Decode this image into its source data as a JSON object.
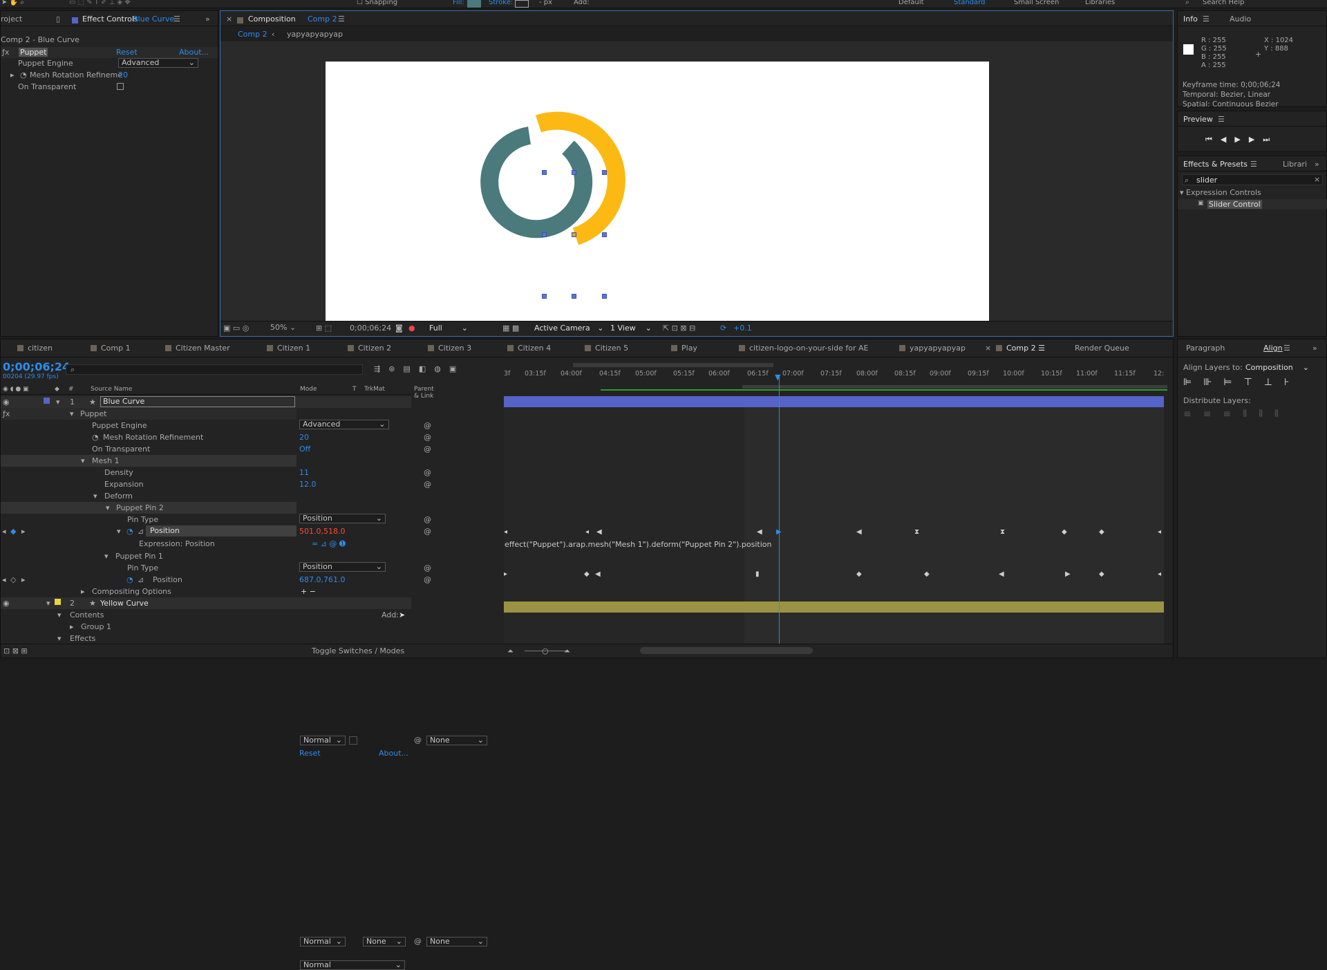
{
  "toolbar": {
    "snapping": "Snapping",
    "fill": "Fill:",
    "stroke": "Stroke:",
    "px": "- px",
    "add": "Add:",
    "workspaces": [
      "Default",
      "Standard",
      "Small Screen",
      "Libraries"
    ],
    "search_placeholder": "Search Help"
  },
  "effect_controls": {
    "project_tab": "roject",
    "tab_label": "Effect Controls",
    "tab_layer": "Blue Curve",
    "breadcrumb": "Comp 2 - Blue Curve",
    "effect_name": "Puppet",
    "reset": "Reset",
    "about": "About...",
    "rows": [
      {
        "label": "Puppet Engine",
        "value": "Advanced"
      },
      {
        "label": "Mesh Rotation Refineme",
        "value": "20"
      },
      {
        "label": "On Transparent",
        "value": ""
      }
    ]
  },
  "composition": {
    "tab_prefix": "Composition",
    "tab_name": "Comp 2",
    "sub_tabs": [
      "Comp 2",
      "yapyapyapyap"
    ],
    "zoom": "50%",
    "timecode": "0;00;06;24",
    "resolution": "Full",
    "camera": "Active Camera",
    "views": "1 View",
    "exposure": "+0.1"
  },
  "info": {
    "tab": "Info",
    "audio_tab": "Audio",
    "rgba": [
      "R : 255",
      "G : 255",
      "B : 255",
      "A : 255"
    ],
    "x": "X : 1024",
    "y": "Y : 888",
    "keyframe_time": "Keyframe time: 0;00;06;24",
    "temporal": "Temporal: Bezier, Linear",
    "spatial": "Spatial: Continuous Bezier"
  },
  "preview": {
    "tab": "Preview"
  },
  "effects_presets": {
    "tab": "Effects & Presets",
    "libraries_tab": "Librari",
    "search_value": "slider",
    "category": "Expression Controls",
    "item": "Slider Control"
  },
  "timeline_tabs": [
    "citizen",
    "Comp 1",
    "Citizen Master",
    "Citizen 1",
    "Citizen 2",
    "Citizen 3",
    "Citizen 4",
    "Citizen 5",
    "Play",
    "citizen-logo-on-your-side for AE",
    "yapyapyapyap",
    "Comp 2",
    "Render Queue"
  ],
  "timeline": {
    "timecode": "0;00;06;24",
    "fps": "00204 (29.97 fps)",
    "columns": {
      "source": "Source Name",
      "mode": "Mode",
      "t": "T",
      "trkmat": "TrkMat",
      "parent": "Parent & Link",
      "num": "#"
    },
    "ruler": [
      "3f",
      "03:15f",
      "04:00f",
      "04:15f",
      "05:00f",
      "05:15f",
      "06:00f",
      "06:15f",
      "07:00f",
      "07:15f",
      "08:00f",
      "08:15f",
      "09:00f",
      "09:15f",
      "10:00f",
      "10:15f",
      "11:00f",
      "11:15f",
      "12:"
    ],
    "layer1": {
      "num": "1",
      "name": "Blue Curve",
      "mode": "Normal",
      "parent": "None"
    },
    "puppet": {
      "label": "Puppet",
      "reset": "Reset",
      "about": "About..."
    },
    "props": [
      {
        "label": "Puppet Engine",
        "value": "Advanced"
      },
      {
        "label": "Mesh Rotation Refinement",
        "value": "20"
      },
      {
        "label": "On Transparent",
        "value": "Off"
      },
      {
        "label": "Mesh 1",
        "value": ""
      },
      {
        "label": "Density",
        "value": "11"
      },
      {
        "label": "Expansion",
        "value": "12.0"
      },
      {
        "label": "Deform",
        "value": ""
      },
      {
        "label": "Puppet Pin 2",
        "value": ""
      },
      {
        "label": "Pin Type",
        "value": "Position"
      },
      {
        "label": "Position",
        "value": "501.0,518.0"
      },
      {
        "label": "Expression: Position",
        "value": ""
      },
      {
        "label": "Puppet Pin 1",
        "value": ""
      },
      {
        "label": "Pin Type",
        "value": "Position"
      },
      {
        "label": "Position",
        "value": "687.0,761.0"
      },
      {
        "label": "Compositing Options",
        "value": ""
      }
    ],
    "expression": "effect(\"Puppet\").arap.mesh(\"Mesh 1\").deform(\"Puppet Pin 2\").position",
    "layer2": {
      "num": "2",
      "name": "Yellow Curve",
      "mode": "Normal",
      "trkmat": "None",
      "parent": "None"
    },
    "contents": "Contents",
    "add": "Add:",
    "group1": "Group 1",
    "group1_mode": "Normal",
    "effects": "Effects",
    "toggle": "Toggle Switches / Modes"
  },
  "align": {
    "paragraph_tab": "Paragraph",
    "tab": "Align",
    "align_to_label": "Align Layers to:",
    "align_to_value": "Composition",
    "distribute": "Distribute Layers:"
  },
  "colors": {
    "accent": "#2d8ceb",
    "yellow": "#fdb913",
    "teal": "#4a7a7c",
    "layer_bar": "#5663c8",
    "yellow_bar": "#9a9343"
  }
}
